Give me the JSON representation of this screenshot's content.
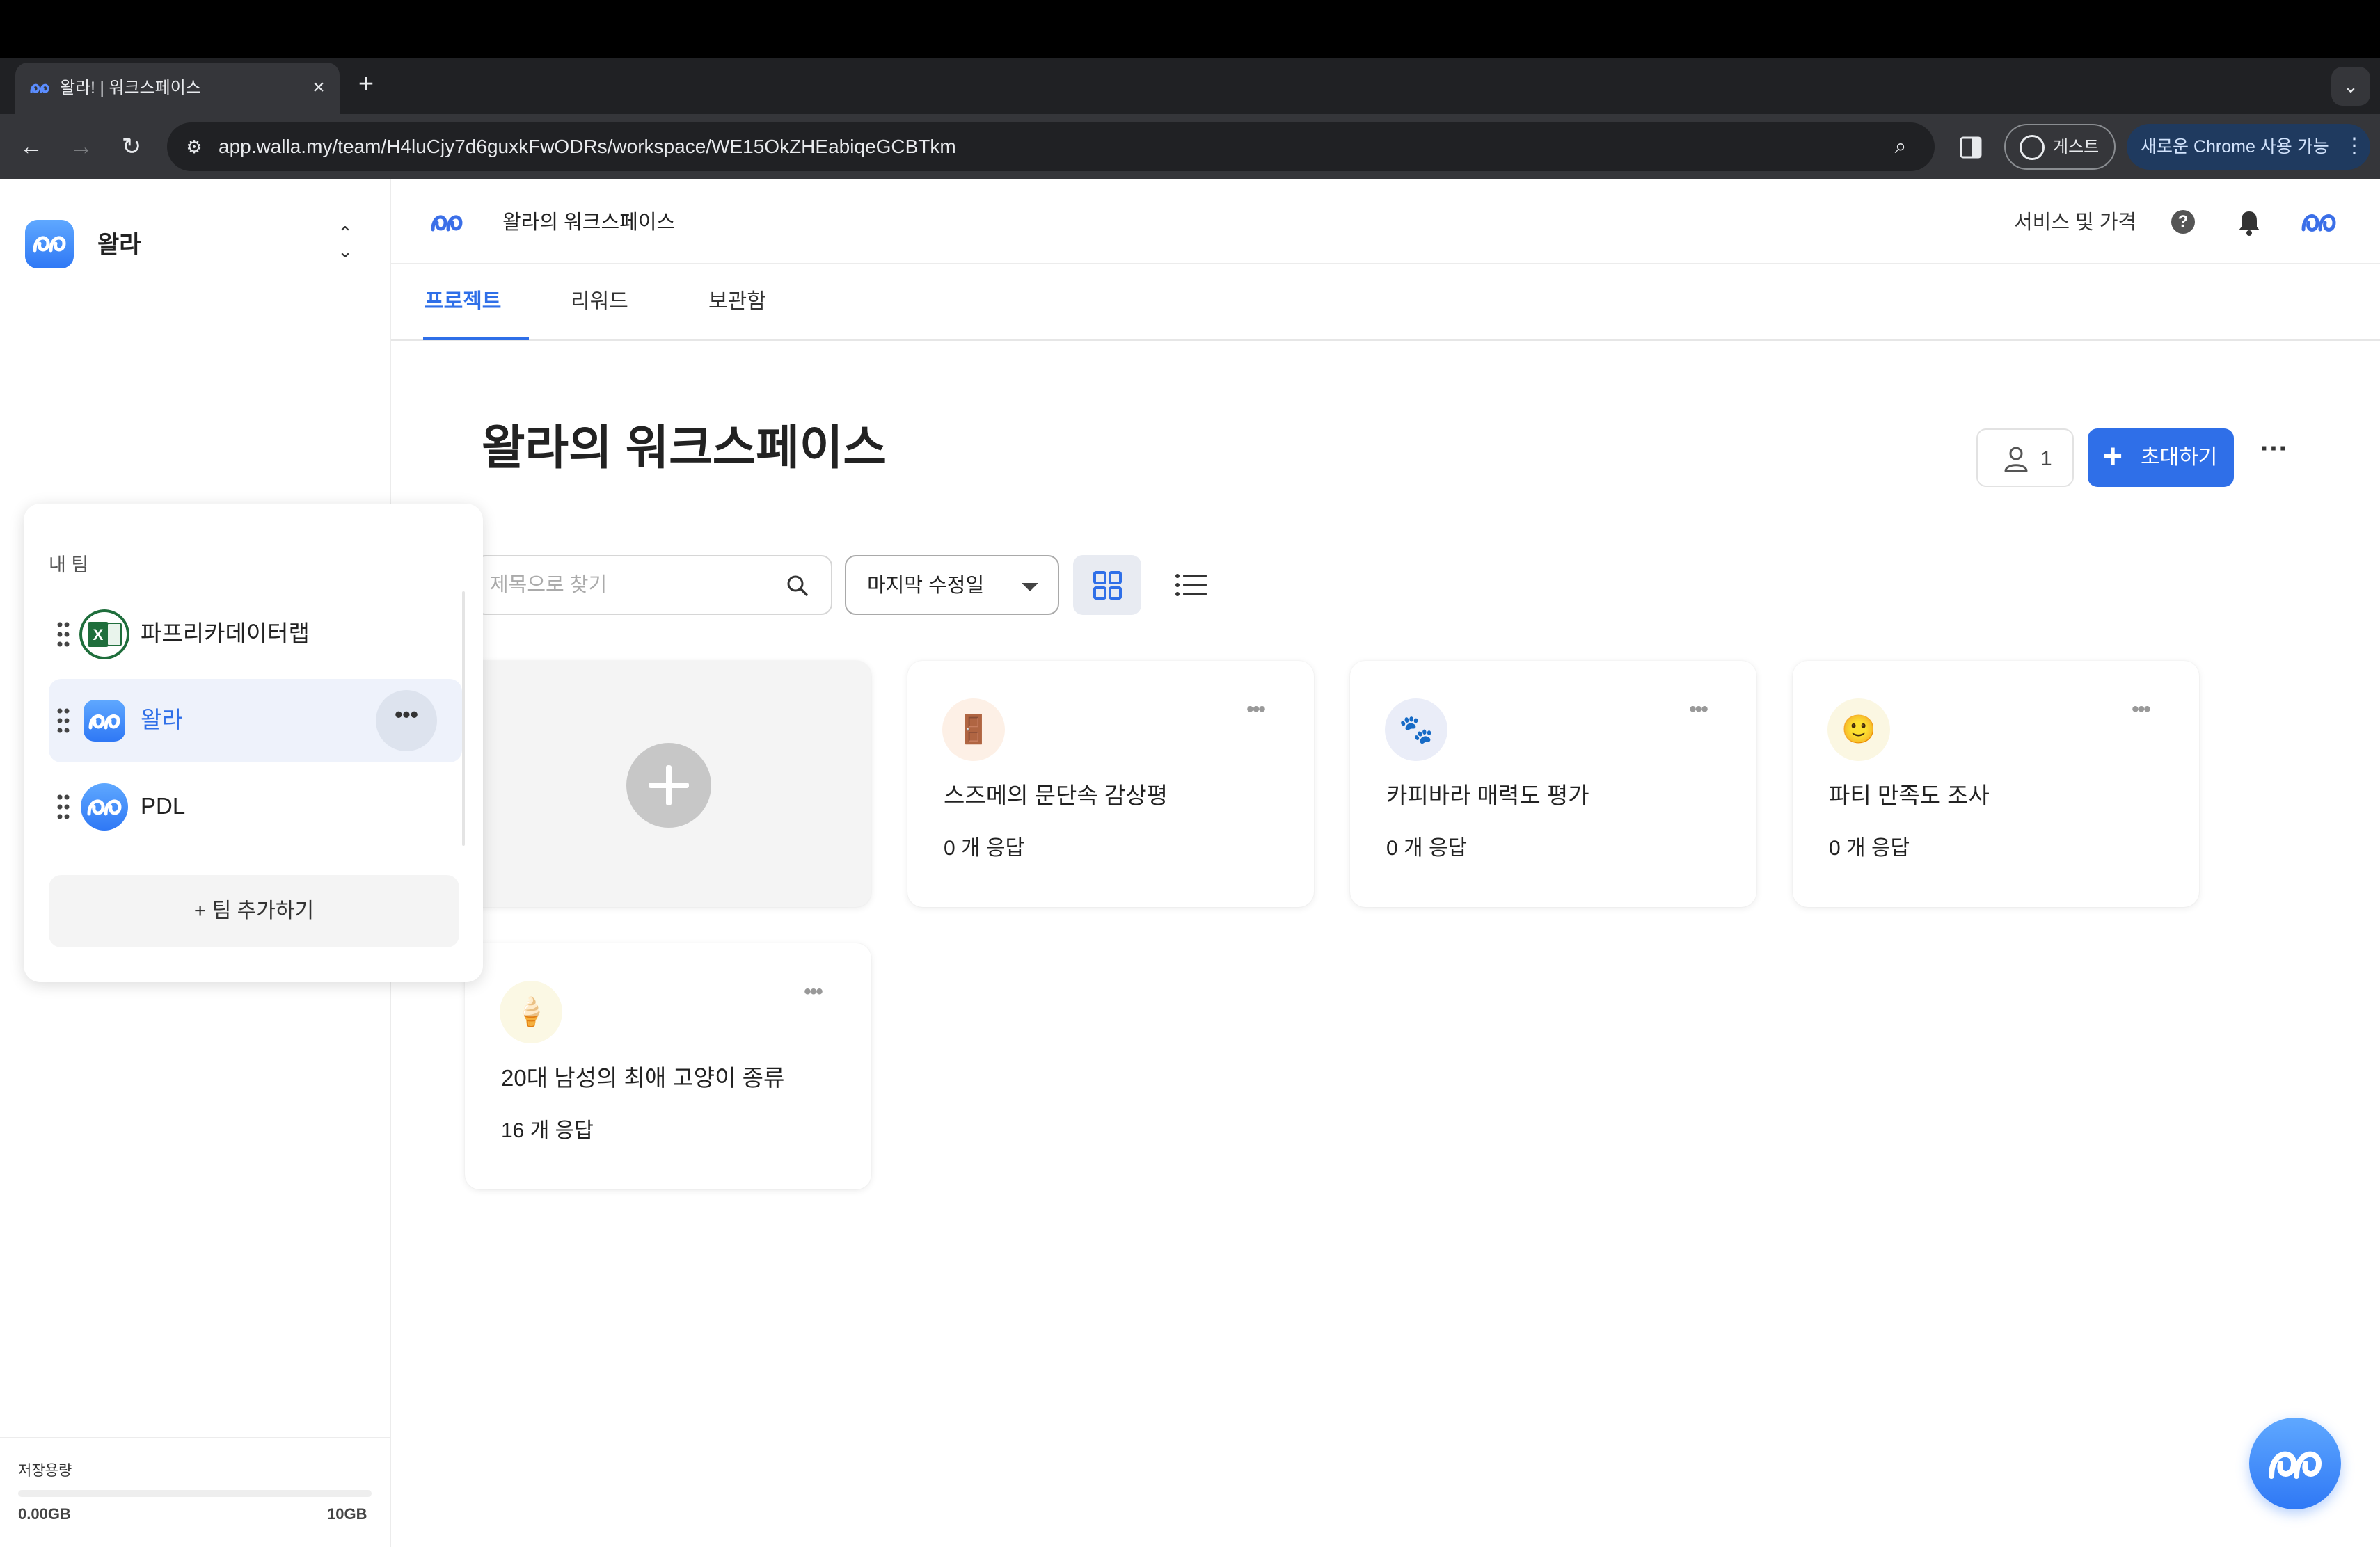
{
  "browser": {
    "tab_title": "왈라! | 워크스페이스",
    "url": "app.walla.my/team/H4luCjy7d6guxkFwODRs/workspace/WE15OkZHEabiqeGCBTkm",
    "profile_label": "게스트",
    "update_label": "새로운 Chrome 사용 가능"
  },
  "sidebar": {
    "team_name": "왈라",
    "storage": {
      "title": "저장용량",
      "used": "0.00GB",
      "max": "10GB",
      "used_fraction": 0
    }
  },
  "team_popover": {
    "title": "내 팀",
    "teams": [
      {
        "label": "파프리카데이터랩"
      },
      {
        "label": "왈라",
        "selected": true
      },
      {
        "label": "PDL"
      }
    ],
    "add_label": "+ 팀 추가하기"
  },
  "header": {
    "workspace_title": "왈라의 워크스페이스",
    "service_link": "서비스 및 가격"
  },
  "tabs": [
    {
      "label": "프로젝트",
      "active": true
    },
    {
      "label": "리워드"
    },
    {
      "label": "보관함"
    }
  ],
  "main": {
    "page_title": "왈라의 워크스페이스",
    "member_count": "1",
    "invite_label": "초대하기",
    "search_placeholder": "제목으로 찾기",
    "sort_label": "마지막 수정일"
  },
  "projects": [
    {
      "title": "스즈메의 문단속 감상평",
      "count": "0 개 응답",
      "emoji": "🚪",
      "bg": "#fdf0e6"
    },
    {
      "title": "카피바라 매력도 평가",
      "count": "0 개 응답",
      "emoji": "🐾",
      "bg": "#eaedf8"
    },
    {
      "title": "파티 만족도 조사",
      "count": "0 개 응답",
      "emoji": "🙂",
      "bg": "#fbf7e2"
    },
    {
      "title": "20대 남성의 최애 고양이 종류",
      "count": "16 개 응답",
      "emoji": "🍦",
      "bg": "#fbf8e4"
    }
  ],
  "colors": {
    "accent": "#2f6fe8",
    "brand_gradient_top": "#5fa8ff",
    "brand_gradient_bottom": "#2f78f5"
  }
}
